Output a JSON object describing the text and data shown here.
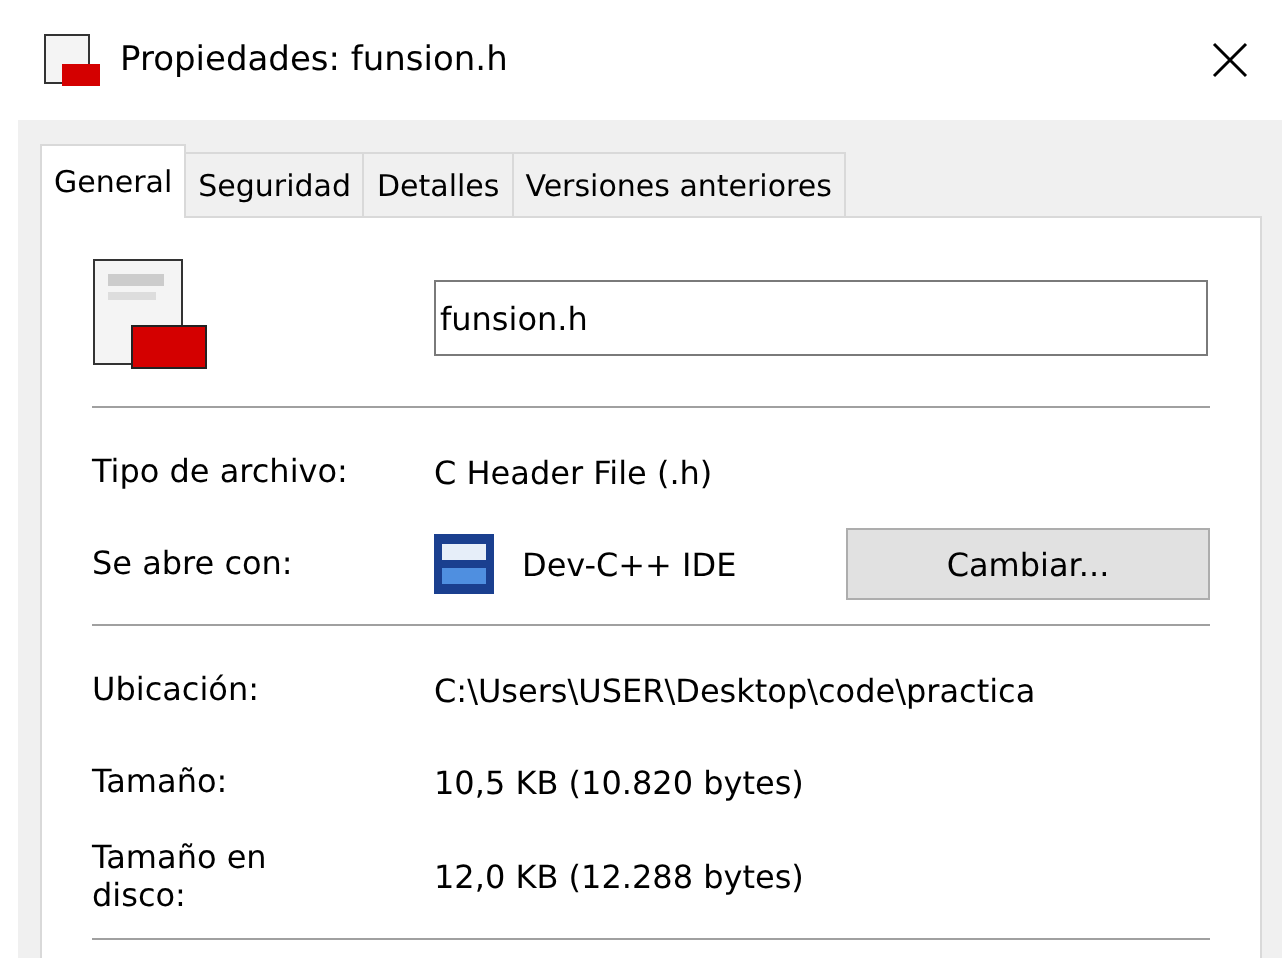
{
  "window": {
    "title": "Propiedades: funsion.h"
  },
  "tabs": [
    {
      "label": "General",
      "selected": true
    },
    {
      "label": "Seguridad",
      "selected": false
    },
    {
      "label": "Detalles",
      "selected": false
    },
    {
      "label": "Versiones anteriores",
      "selected": false
    }
  ],
  "file_name": "funsion.h",
  "sections": [
    {
      "rows": [
        {
          "kind": "text",
          "label": "Tipo de archivo:",
          "value": "C Header File (.h)"
        },
        {
          "kind": "app",
          "label": "Se abre con:",
          "value": "Dev-C++ IDE",
          "button": "Cambiar..."
        }
      ]
    },
    {
      "rows": [
        {
          "kind": "text",
          "label": "Ubicación:",
          "value": "C:\\Users\\USER\\Desktop\\code\\practica"
        },
        {
          "kind": "text",
          "label": "Tamaño:",
          "value": "10,5 KB (10.820 bytes)"
        },
        {
          "kind": "text",
          "label": "Tamaño en disco:",
          "value": "12,0 KB (12.288 bytes)"
        }
      ]
    }
  ]
}
